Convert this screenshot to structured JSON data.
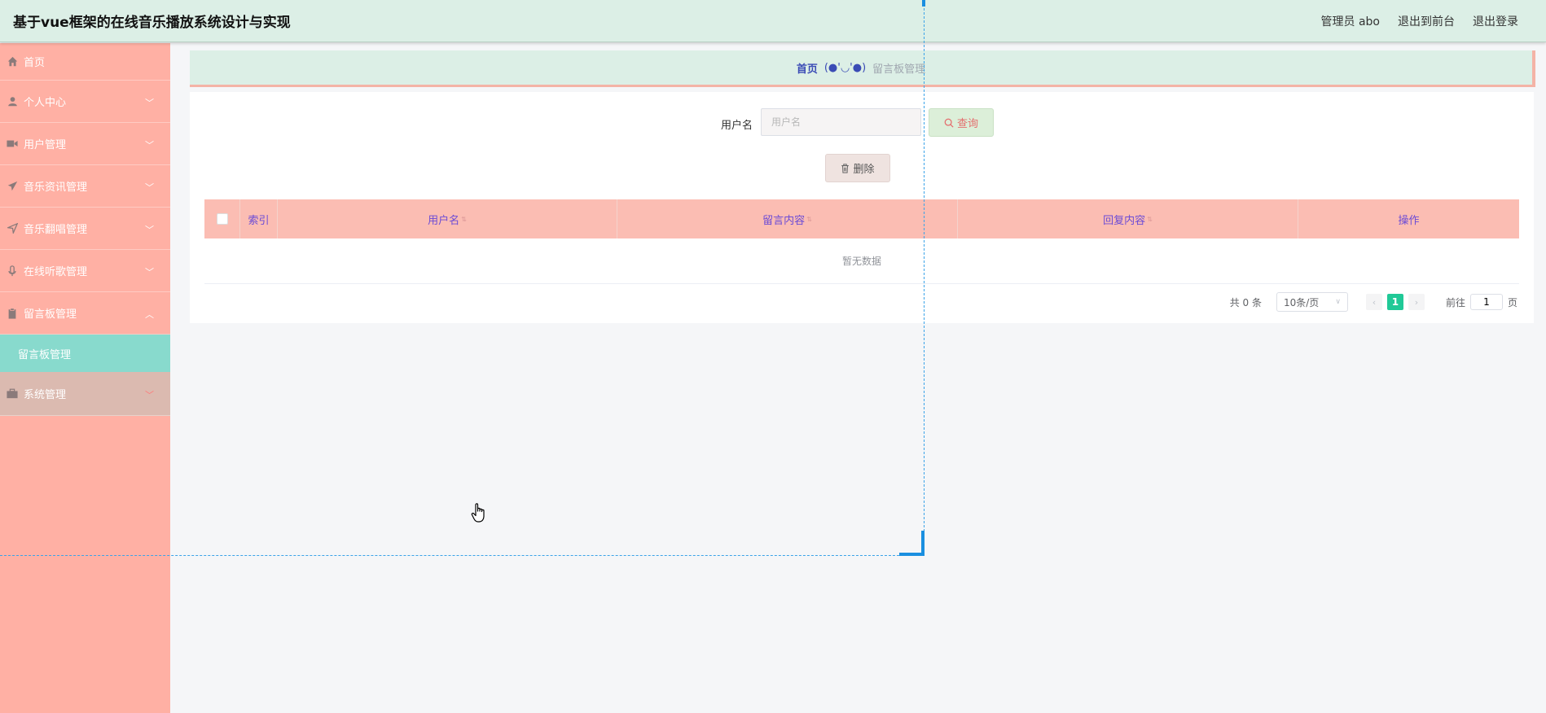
{
  "header": {
    "title": "基于vue框架的在线音乐播放系统设计与实现",
    "links": [
      "管理员 abo",
      "退出到前台",
      "退出登录"
    ]
  },
  "sidebar": {
    "items": [
      {
        "label": "首页",
        "icon": "home-icon"
      },
      {
        "label": "个人中心",
        "icon": "user-icon"
      },
      {
        "label": "用户管理",
        "icon": "video-camera-icon"
      },
      {
        "label": "音乐资讯管理",
        "icon": "paper-plane-icon"
      },
      {
        "label": "音乐翻唱管理",
        "icon": "navigation-arrow-icon"
      },
      {
        "label": "在线听歌管理",
        "icon": "microphone-icon"
      },
      {
        "label": "留言板管理",
        "icon": "clipboard-icon"
      },
      {
        "label": "系统管理",
        "icon": "briefcase-icon"
      }
    ],
    "submenu_active": "留言板管理"
  },
  "breadcrumb": {
    "home": "首页",
    "face": "(●'◡'●)",
    "current": "留言板管理"
  },
  "search": {
    "label": "用户名",
    "placeholder": "用户名",
    "button": "查询"
  },
  "actions": {
    "delete": "删除"
  },
  "table": {
    "columns": [
      "索引",
      "用户名",
      "留言内容",
      "回复内容",
      "操作"
    ],
    "empty_text": "暂无数据"
  },
  "pagination": {
    "total": "共 0 条",
    "page_size": "10条/页",
    "current_page": "1",
    "goto_prefix": "前往",
    "goto_value": "1",
    "goto_suffix": "页"
  },
  "colors": {
    "header_bg": "#dcefe6",
    "sidebar_bg": "#ffb0a4",
    "submenu_active_bg": "#88dacd",
    "table_header_bg": "#fbbdb3",
    "page_active": "#20c997"
  }
}
